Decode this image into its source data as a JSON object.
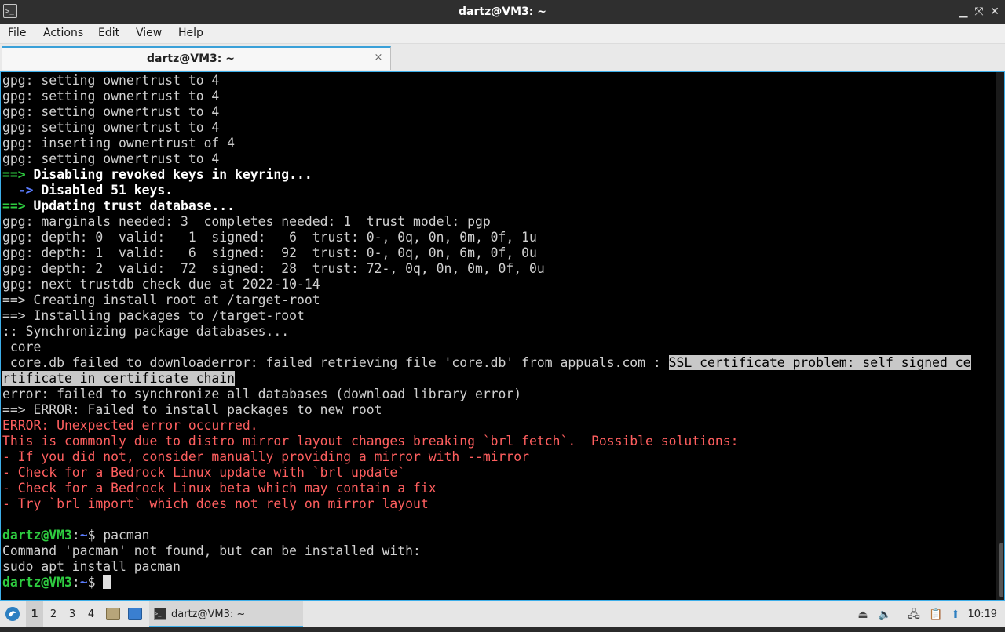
{
  "window": {
    "title": "dartz@VM3: ~",
    "app_icon": "terminal-icon",
    "controls": {
      "minimize": "minimize-icon",
      "maximize": "maximize-icon",
      "close": "close-icon"
    }
  },
  "menu": [
    "File",
    "Actions",
    "Edit",
    "View",
    "Help"
  ],
  "tab": {
    "label": "dartz@VM3: ~",
    "close_glyph": "×"
  },
  "terminal": {
    "lines": [
      "gpg: setting ownertrust to 4",
      "gpg: setting ownertrust to 4",
      "gpg: setting ownertrust to 4",
      "gpg: setting ownertrust to 4",
      "gpg: inserting ownertrust of 4",
      "gpg: setting ownertrust to 4",
      {
        "arrow": "==>",
        "text": " Disabling revoked keys in keyring..."
      },
      {
        "sub_arrow": "  ->",
        "text": " Disabled 51 keys."
      },
      {
        "arrow": "==>",
        "text": " Updating trust database..."
      },
      "gpg: marginals needed: 3  completes needed: 1  trust model: pgp",
      "gpg: depth: 0  valid:   1  signed:   6  trust: 0-, 0q, 0n, 0m, 0f, 1u",
      "gpg: depth: 1  valid:   6  signed:  92  trust: 0-, 0q, 0n, 6m, 0f, 0u",
      "gpg: depth: 2  valid:  72  signed:  28  trust: 72-, 0q, 0n, 0m, 0f, 0u",
      "gpg: next trustdb check due at 2022-10-14",
      "==> Creating install root at /target-root",
      "==> Installing packages to /target-root",
      ":: Synchronizing package databases...",
      " core",
      {
        "plain": " core.db failed to downloaderror: failed retrieving file 'core.db' from appuals.com : ",
        "selected": "SSL certificate problem: self signed ce"
      },
      {
        "selected": "rtificate in certificate chain"
      },
      "error: failed to synchronize all databases (download library error)",
      "==> ERROR: Failed to install packages to new root",
      {
        "error": "ERROR: Unexpected error occurred."
      },
      {
        "error": "This is commonly due to distro mirror layout changes breaking `brl fetch`.  Possible solutions:"
      },
      {
        "error": "- If you did not, consider manually providing a mirror with --mirror"
      },
      {
        "error": "- Check for a Bedrock Linux update with `brl update`"
      },
      {
        "error": "- Check for a Bedrock Linux beta which may contain a fix"
      },
      {
        "error": "- Try `brl import` which does not rely on mirror layout"
      },
      "",
      {
        "prompt_user": "dartz@VM3",
        "prompt_sep": ":",
        "prompt_path": "~",
        "prompt_sign": "$ ",
        "command": "pacman"
      },
      "Command 'pacman' not found, but can be installed with:",
      "sudo apt install pacman",
      {
        "prompt_user": "dartz@VM3",
        "prompt_sep": ":",
        "prompt_path": "~",
        "prompt_sign": "$ ",
        "command": "",
        "cursor": true
      }
    ]
  },
  "taskbar": {
    "start_icon": "bedrock-menu-icon",
    "desktops": [
      "1",
      "2",
      "3",
      "4"
    ],
    "active_desktop": "1",
    "quick_launch": [
      "file-manager-icon",
      "show-desktop-icon"
    ],
    "task": {
      "icon": "terminal-icon",
      "label": "dartz@VM3: ~"
    },
    "tray": [
      "eject-icon",
      "volume-icon",
      "network-icon",
      "clipboard-icon",
      "updates-icon"
    ],
    "clock": "10:19"
  }
}
